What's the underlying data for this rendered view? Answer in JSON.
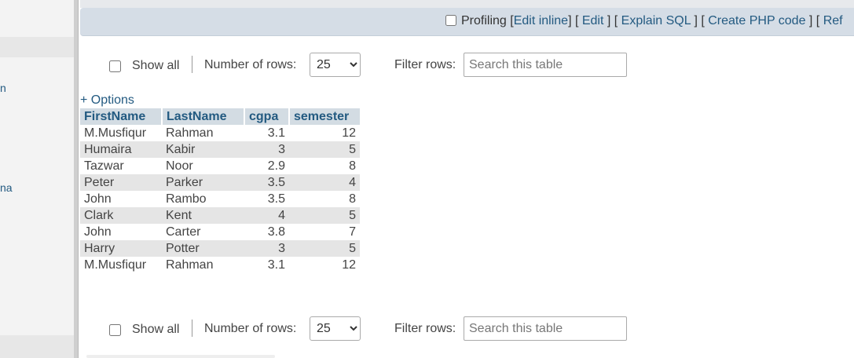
{
  "sidebar": {
    "fragments": [
      "n",
      "na"
    ]
  },
  "profiling": {
    "label": "Profiling",
    "links": [
      "Edit inline",
      "Edit",
      "Explain SQL",
      "Create PHP code",
      "Ref"
    ]
  },
  "controls": {
    "show_all": "Show all",
    "number_of_rows_label": "Number of rows:",
    "rows_value": "25",
    "filter_label": "Filter rows:",
    "search_placeholder": "Search this table"
  },
  "options_link": "+ Options",
  "table": {
    "columns": [
      "FirstName",
      "LastName",
      "cgpa",
      "semester"
    ],
    "rows": [
      [
        "M.Musfiqur",
        "Rahman",
        "3.1",
        "12"
      ],
      [
        "Humaira",
        "Kabir",
        "3",
        "5"
      ],
      [
        "Tazwar",
        "Noor",
        "2.9",
        "8"
      ],
      [
        "Peter",
        "Parker",
        "3.5",
        "4"
      ],
      [
        "John",
        "Rambo",
        "3.5",
        "8"
      ],
      [
        "Clark",
        "Kent",
        "4",
        "5"
      ],
      [
        "John",
        "Carter",
        "3.8",
        "7"
      ],
      [
        "Harry",
        "Potter",
        "3",
        "5"
      ],
      [
        "M.Musfiqur",
        "Rahman",
        "3.1",
        "12"
      ]
    ]
  }
}
